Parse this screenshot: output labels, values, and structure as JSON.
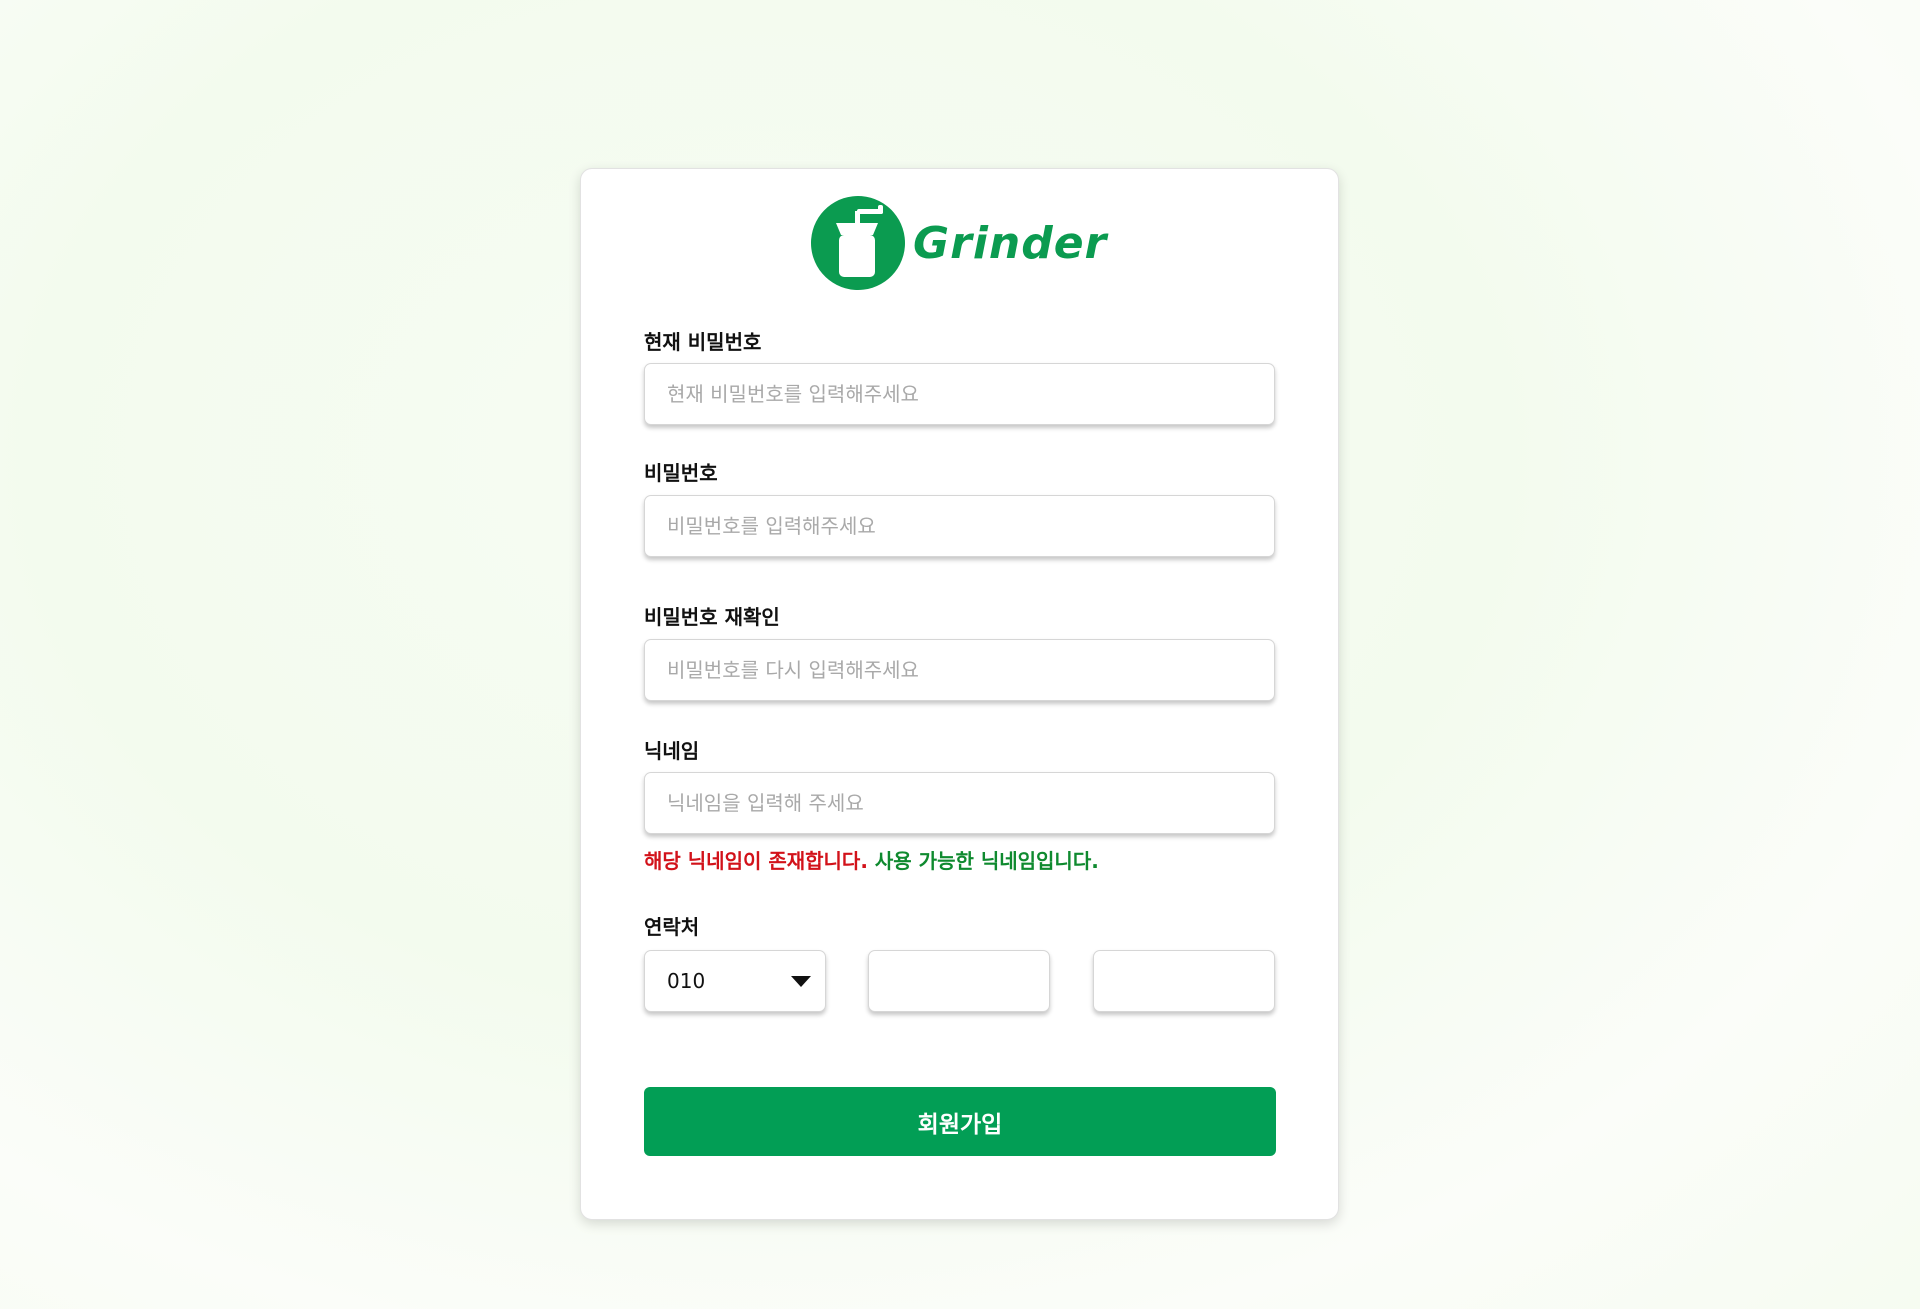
{
  "brand": {
    "name": "Grinder",
    "color": "#0b9b50"
  },
  "form": {
    "current_password": {
      "label": "현재 비밀번호",
      "placeholder": "현재 비밀번호를 입력해주세요",
      "value": ""
    },
    "password": {
      "label": "비밀번호",
      "placeholder": "비밀번호를 입력해주세요",
      "value": ""
    },
    "password_confirm": {
      "label": "비밀번호 재확인",
      "placeholder": "비밀번호를 다시 입력해주세요",
      "value": ""
    },
    "nickname": {
      "label": "닉네임",
      "placeholder": "닉네임을 입력해 주세요",
      "value": "",
      "error_message": "해당 닉네임이 존재합니다.",
      "success_message": "사용 가능한 닉네임입니다.",
      "error_color": "#d2121a",
      "success_color": "#0f8a2f"
    },
    "contact": {
      "label": "연락처",
      "prefix_selected": "010",
      "middle": "",
      "last": ""
    },
    "submit_label": "회원가입",
    "submit_color": "#029e55"
  },
  "icons": {
    "logo": "coffee-grinder-icon",
    "dropdown": "caret-down-icon"
  }
}
